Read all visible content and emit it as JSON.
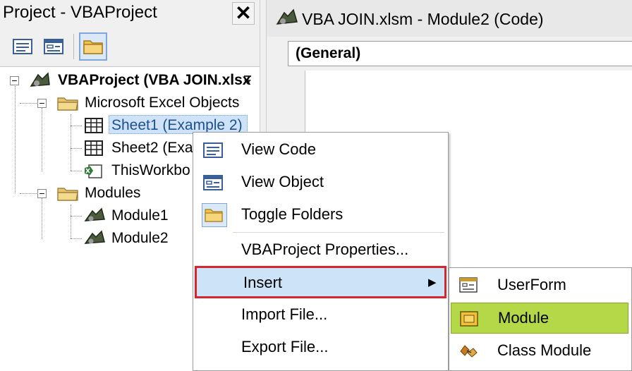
{
  "project": {
    "title": "Project - VBAProject",
    "close_glyph": "✕",
    "tree": {
      "root": "VBAProject (VBA JOIN.xlsx",
      "excel_objects": "Microsoft Excel Objects",
      "sheet1": "Sheet1 (Example 2)",
      "sheet2": "Sheet2 (Exa",
      "thisworkbook": "ThisWorkbo",
      "modules": "Modules",
      "module1": "Module1",
      "module2": "Module2"
    }
  },
  "code_window": {
    "title": "VBA JOIN.xlsm - Module2 (Code)",
    "dropdown_value": "(General)"
  },
  "context_menu": {
    "items": [
      {
        "label": "View Code"
      },
      {
        "label": "View Object"
      },
      {
        "label": "Toggle Folders"
      },
      {
        "label": "VBAProject Properties..."
      },
      {
        "label": "Insert"
      },
      {
        "label": "Import File..."
      },
      {
        "label": "Export File..."
      }
    ],
    "highlight_color": "#d9262e"
  },
  "insert_submenu": {
    "items": [
      {
        "label": "UserForm"
      },
      {
        "label": "Module"
      },
      {
        "label": "Class Module"
      }
    ],
    "selected_color": "#b4d848"
  }
}
